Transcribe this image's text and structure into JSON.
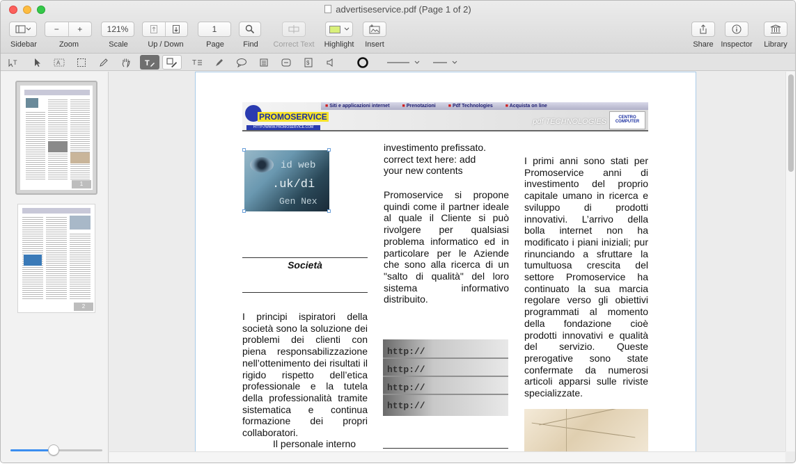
{
  "window": {
    "title": "advertiseservice.pdf (Page 1 of 2)"
  },
  "toolbar": {
    "sidebar_label": "Sidebar",
    "zoom_label": "Zoom",
    "zoom_minus": "−",
    "zoom_plus": "+",
    "scale_value": "121%",
    "scale_label": "Scale",
    "updown_label": "Up / Down",
    "page_value": "1",
    "page_label": "Page",
    "find_label": "Find",
    "correct_text_label": "Correct Text",
    "highlight_label": "Highlight",
    "highlight_color": "#d9f07a",
    "insert_label": "Insert",
    "share_label": "Share",
    "inspector_label": "Inspector",
    "library_label": "Library"
  },
  "annotation_bar": {
    "icons": [
      "text-selection-icon",
      "arrow-select-icon",
      "text-select-icon",
      "rect-select-icon",
      "pencil-icon",
      "hand-icon",
      "text-edit-icon",
      "pen-edit-icon",
      "text-box-icon",
      "highlighter-icon",
      "speech-bubble-icon",
      "note-icon",
      "link-icon",
      "stamp-icon",
      "sound-icon",
      "circle-stroke-icon",
      "line-style-icon",
      "line-width-icon"
    ]
  },
  "sidebar": {
    "pages": [
      {
        "badge": "1",
        "selected": true
      },
      {
        "badge": "2",
        "selected": false
      }
    ],
    "zoom_slider_fraction": 0.47
  },
  "document": {
    "banner": {
      "nav": [
        "Siti e applicazioni internet",
        "Prenotazioni",
        "Pdf Technologies",
        "Acquista on line"
      ],
      "logo": "PROMOSERVICE",
      "logo_url": "HTTP://WWW.PROMOSERVICE.COM",
      "pdf_tech": "pdf TECHNOLOGIES",
      "centro": "CENTRO COMPUTER"
    },
    "heading": "Società",
    "col1_text": "I principi ispiratori della società sono la soluzione dei problemi dei clienti con piena responsabilizzazione nell’ottenimento dei risultati il rigido rispetto dell’etica professionale e la tutela della professionalità tramite sistematica e continua formazione dei propri collaboratori.",
    "col1_text2": "Il personale interno",
    "col2_line1": "investimento prefissato.",
    "col2_line2": "correct text here: add",
    "col2_line3": "your new contents",
    "col2_text": "Promoservice si propone quindi come il partner ideale al quale il Cliente si può rivolgere per qualsiasi problema informatico ed in particolare per le Aziende che sono alla ricerca di un \"salto di qualità\" del loro sistema informativo distribuito.",
    "col3_text": "I primi anni sono stati per Promoservice anni di investimento del proprio capitale umano in ricerca e sviluppo di prodotti innovativi. L’arrivo della bolla internet non ha modificato i piani iniziali; pur rinunciando a sfruttare la tumultuosa crescita del settore Promoservice ha continuato la sua marcia regolare verso gli obiettivi programmati al momento della fondazione cioè prodotti innovativi e qualità del servizio. Queste prerogative sono state confermate da numerosi articoli apparsi sulle riviste specializzate.",
    "image1_text": [
      "id web",
      ".uk/di",
      "Gen Nex"
    ],
    "image2_text": [
      "http://",
      "http://",
      "http://",
      "http://"
    ]
  }
}
